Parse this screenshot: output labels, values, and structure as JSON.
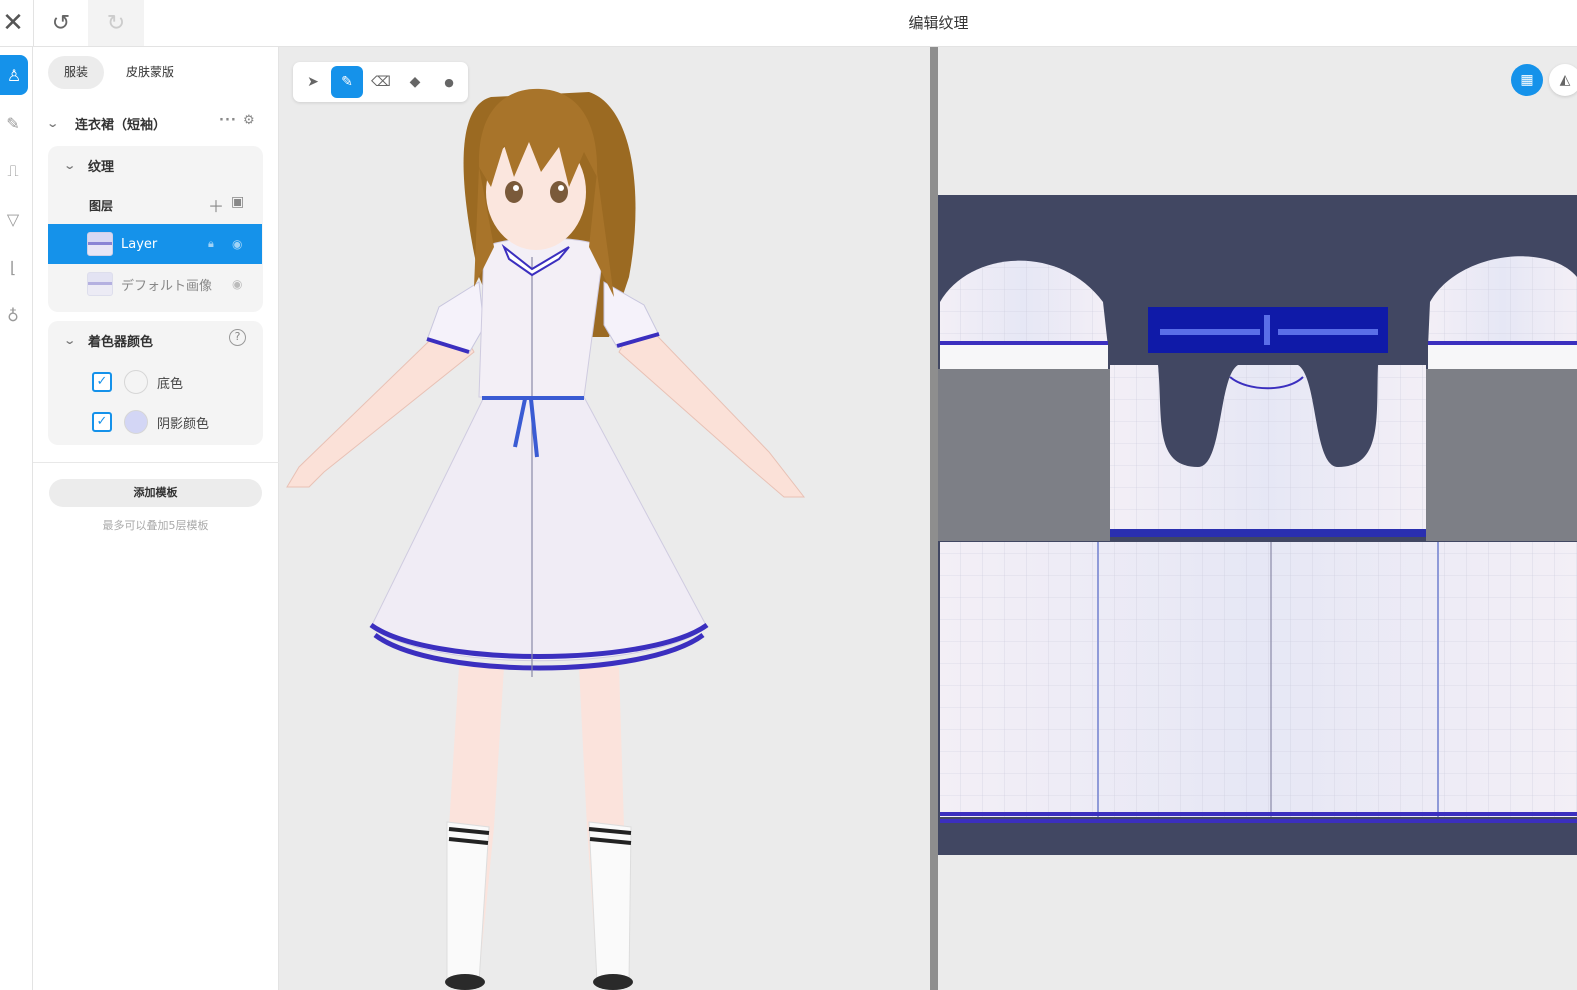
{
  "header": {
    "title": "编辑纹理",
    "close_glyph": "✕",
    "undo_glyph": "↺",
    "redo_glyph": "↻"
  },
  "rail": {
    "items": [
      {
        "icon": "dress-icon",
        "glyph": "♙",
        "active": true
      },
      {
        "icon": "brush-icon",
        "glyph": "✎",
        "active": false
      },
      {
        "icon": "top-icon",
        "glyph": "⎍",
        "active": false
      },
      {
        "icon": "bottom-icon",
        "glyph": "▽",
        "active": false
      },
      {
        "icon": "shoe-icon",
        "glyph": "⌊",
        "active": false
      },
      {
        "icon": "accessory-icon",
        "glyph": "♁",
        "active": false
      }
    ]
  },
  "panel": {
    "tabs": {
      "outfit": "服装",
      "skin_mask": "皮肤蒙版"
    },
    "garment_name": "连衣裙（短袖）",
    "texture_section": "纹理",
    "layers_label": "图层",
    "layers": [
      {
        "name": "Layer",
        "selected": true
      },
      {
        "name": "デフォルト画像",
        "selected": false
      }
    ],
    "shader_section": "着色器颜色",
    "colors": [
      {
        "label": "底色",
        "hex": "#ffffff",
        "checked": true
      },
      {
        "label": "阴影颜色",
        "hex": "#d3d6f5",
        "checked": true
      }
    ],
    "add_template": "添加模板",
    "hint": "最多可以叠加5层模板"
  },
  "toolbar": {
    "tools": [
      {
        "name": "select-tool",
        "glyph": "➤",
        "active": false
      },
      {
        "name": "pen-tool",
        "glyph": "✎",
        "active": true
      },
      {
        "name": "eraser-tool",
        "glyph": "⌫",
        "active": false
      },
      {
        "name": "fill-tool",
        "glyph": "◆",
        "active": false
      },
      {
        "name": "eyedropper-tool",
        "glyph": "💧",
        "active": false
      }
    ]
  },
  "colors": {
    "accent": "#1592ea",
    "dress_white": "#f3eff6",
    "dress_trim": "#3b2fbf",
    "hair": "#9b6a22",
    "uv_bg": "#414762"
  }
}
